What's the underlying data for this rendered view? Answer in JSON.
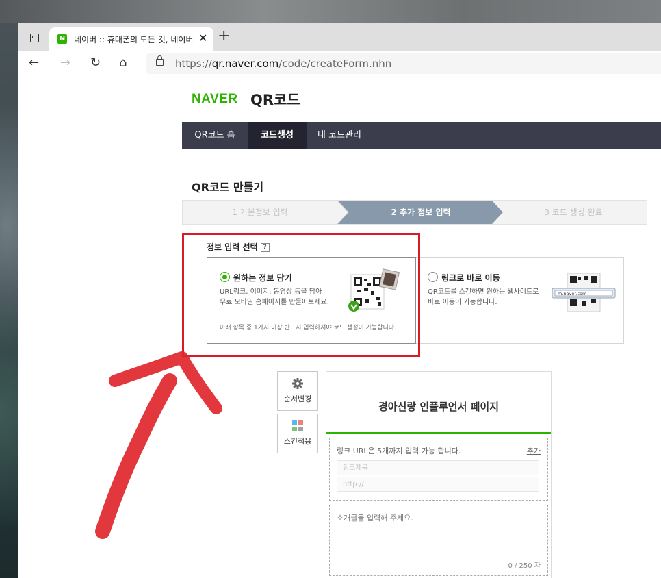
{
  "browser": {
    "tab_title": "네이버 :: 휴대폰의 모든 것, 네이버",
    "favicon_letter": "N",
    "url_scheme": "https://",
    "url_host": "qr.naver.com",
    "url_path": "/code/createForm.nhn"
  },
  "header": {
    "logo": "NAVER",
    "service_name": "QR코드"
  },
  "gnb": {
    "items": [
      "QR코드 홈",
      "코드생성",
      "내 코드관리"
    ],
    "active_index": 1
  },
  "section_title": "QR코드 만들기",
  "steps": {
    "items": [
      "1 기본정보 입력",
      "2 추가 정보 입력",
      "3 코드 생성 완료"
    ],
    "active_index": 1
  },
  "info_select": {
    "label": "정보 입력 선택",
    "help": "?",
    "option1": {
      "title": "원하는 정보 담기",
      "desc_line1": "URL링크, 이미지, 동영상 등을 담아",
      "desc_line2": "무료 모바일 홈페이지를 만들어보세요.",
      "note": "아래 항목 중 1가지 이상 반드시 입력하셔야 코드 생성이 가능합니다.",
      "selected": true
    },
    "option2": {
      "title": "링크로 바로 이동",
      "desc_line1": "QR코드를 스캔하면 원하는 웹사이트로",
      "desc_line2": "바로 이동이 가능합니다.",
      "url_sample": "m.naver.com",
      "selected": false
    }
  },
  "side_buttons": {
    "order_label": "순서변경",
    "skin_label": "스킨적용"
  },
  "editor": {
    "page_title": "경아신랑 인플루언서 페이지",
    "link_hint": "링크 URL은 5개까지 입력 가능 합니다.",
    "link_add": "추가",
    "link_title_placeholder": "링크제목",
    "link_url_placeholder": "http://",
    "intro_placeholder": "소개글을 입력해 주세요.",
    "counter": "0 / 250 자"
  },
  "colors": {
    "naver_green": "#2db400",
    "gnb_bg": "#3b3c4c",
    "annotation_red": "#d91c24"
  }
}
